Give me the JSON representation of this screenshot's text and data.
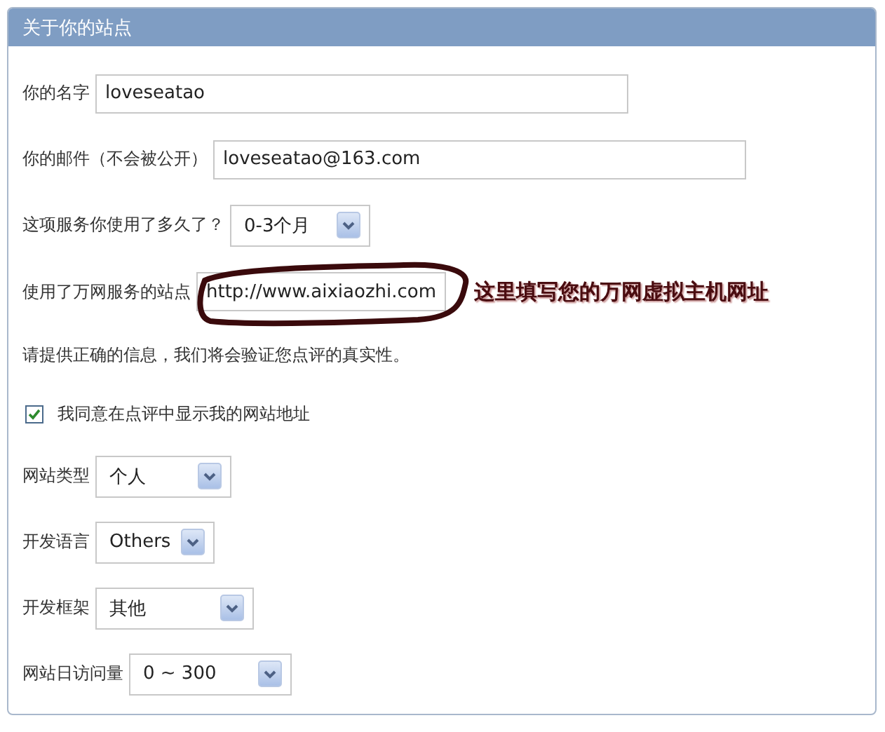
{
  "panel": {
    "title": "关于你的站点"
  },
  "fields": [
    {
      "kind": "text",
      "label": "你的名字",
      "value": "loveseatao"
    },
    {
      "kind": "text",
      "label": "你的邮件（不会被公开）",
      "value": "loveseatao@163.com"
    },
    {
      "kind": "select",
      "label": "这项服务你使用了多久了？",
      "value": "0-3个月"
    },
    {
      "kind": "text",
      "label": "使用了万网服务的站点",
      "value": "http://www.aixiaozhi.com",
      "annotation": "这里填写您的万网虚拟主机网址"
    },
    {
      "kind": "note",
      "label": "请提供正确的信息，我们将会验证您点评的真实性。"
    },
    {
      "kind": "checkbox",
      "label": "我同意在点评中显示我的网站地址",
      "checked": true
    },
    {
      "kind": "select",
      "label": "网站类型",
      "value": "个人"
    },
    {
      "kind": "select",
      "label": "开发语言",
      "value": "Others"
    },
    {
      "kind": "select",
      "label": "开发框架",
      "value": "其他"
    },
    {
      "kind": "select",
      "label": "网站日访问量",
      "value": "0 ~ 300"
    }
  ]
}
